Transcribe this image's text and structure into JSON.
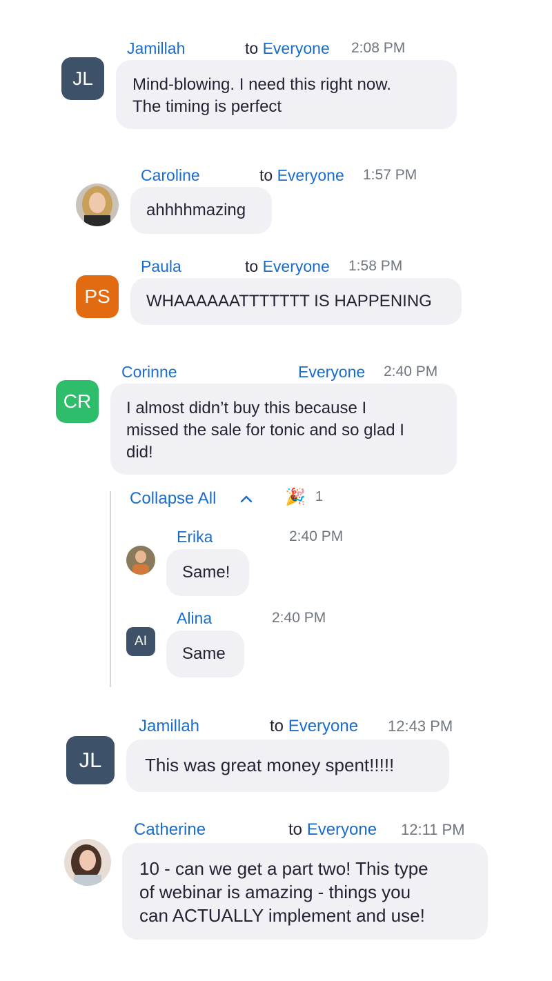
{
  "colors": {
    "link": "#1a6dca",
    "bubble": "#f1f1f5",
    "avatar_dark": "#3d5269",
    "avatar_orange": "#e26b12",
    "avatar_green": "#2ebd6b"
  },
  "messages": [
    {
      "name": "Jamillah",
      "to": "to",
      "recipient": "Everyone",
      "time": "2:08 PM",
      "avatar_initials": "JL",
      "lines": [
        "Mind-blowing.  I need this right now.",
        "The timing is perfect"
      ]
    },
    {
      "name": "Caroline",
      "to": "to",
      "recipient": "Everyone",
      "time": "1:57 PM",
      "avatar_icon": "photo-avatar",
      "lines": [
        "ahhhhmazing"
      ]
    },
    {
      "name": "Paula",
      "to": "to",
      "recipient": "Everyone",
      "time": "1:58 PM",
      "avatar_initials": "PS",
      "lines": [
        "WHAAAAAATTTTTTT IS HAPPENING"
      ]
    },
    {
      "name": "Corinne",
      "recipient": "Everyone",
      "time": "2:40 PM",
      "avatar_initials": "CR",
      "lines": [
        "I almost didn’t buy this because I",
        "missed the sale for tonic and so glad I",
        "did!"
      ]
    },
    {
      "name": "Jamillah",
      "to": "to",
      "recipient": "Everyone",
      "time": "12:43 PM",
      "avatar_initials": "JL",
      "lines": [
        "This was great money spent!!!!!"
      ]
    },
    {
      "name": "Catherine",
      "to": "to",
      "recipient": "Everyone",
      "time": "12:11 PM",
      "avatar_icon": "photo-avatar",
      "lines": [
        "10 - can we get a part two! This type",
        "of webinar is amazing - things you",
        "can ACTUALLY implement and use!"
      ]
    }
  ],
  "thread": {
    "collapse_label": "Collapse All",
    "chevron_icon": "chevron-up-icon",
    "reaction_icon": "party-popper-icon",
    "reaction_emoji": "🎉",
    "reaction_count": "1",
    "replies": [
      {
        "name": "Erika",
        "time": "2:40 PM",
        "avatar_icon": "photo-avatar",
        "text": "Same!"
      },
      {
        "name": "Alina",
        "time": "2:40 PM",
        "avatar_initials": "AI",
        "text": "Same"
      }
    ]
  }
}
